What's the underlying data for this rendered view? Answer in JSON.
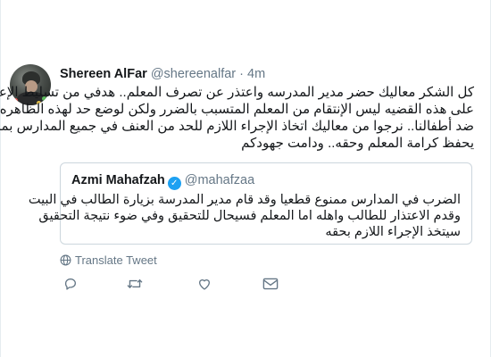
{
  "tweet": {
    "author": {
      "display_name": "Shereen AlFar",
      "handle": "@shereenalfar",
      "separator": "·",
      "timestamp": "4m"
    },
    "text_lines": [
      "كل الشكر معاليك حضر مدير المدرسه واعتذر عن تصرف المعلم.. هدفي من تسليط الإعلام",
      "على هذه القضيه ليس الإنتقام من المعلم المتسبب بالضرر ولكن لوضع حد لهذه الظاهره",
      "ضد أطفالنا.. نرجوا من معاليك اتخاذ الإجراء اللازم للحد من العنف في جميع المدارس بما",
      "يحفظ كرامة المعلم وحقه.. ودامت جهودكم"
    ],
    "quoted": {
      "display_name": "Azmi Mahafzah",
      "verified_mark": "✓",
      "handle": "@mahafzaa",
      "text_lines": [
        "الضرب في المدارس ممنوع قطعيا وقد قام مدير المدرسة بزيارة الطالب في البيت",
        "وقدم الاعتذار للطالب واهله اما المعلم فسيحال للتحقيق وفي ضوء نتيجة التحقيق",
        "سيتخذ الإجراء اللازم بحقه"
      ]
    },
    "translate_label": "Translate Tweet",
    "actions": {
      "reply_icon": "reply-icon",
      "retweet_icon": "retweet-icon",
      "like_icon": "heart-icon",
      "message_icon": "envelope-icon"
    },
    "colors": {
      "text": "#14171a",
      "secondary": "#657786",
      "border": "#ccd6dd",
      "verified": "#1da1f2"
    }
  }
}
